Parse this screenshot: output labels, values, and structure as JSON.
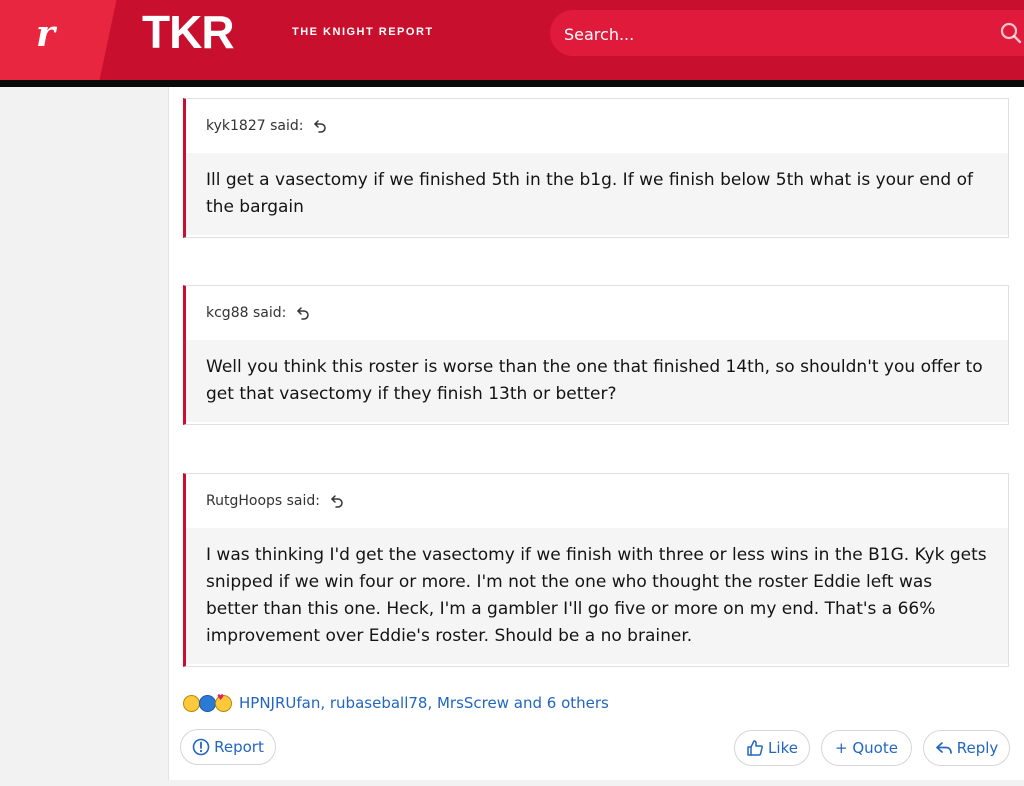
{
  "header": {
    "rivals_logo": "r",
    "brand_logo": "TKR",
    "brand_tagline": "THE KNIGHT REPORT",
    "search": {
      "placeholder": "Search..."
    }
  },
  "quotes": [
    {
      "author_said": "kyk1827 said:",
      "text": "Ill get a vasectomy if we finished 5th in the b1g. If we finish below 5th what is your end of the bargain"
    },
    {
      "author_said": "kcg88 said:",
      "text": "Well you think this roster is worse than the one that finished 14th, so shouldn't you offer to get that vasectomy if they finish 13th or better?"
    },
    {
      "author_said": "RutgHoops said:",
      "text": "I was thinking I'd get the vasectomy if we finish with three or less wins in the B1G. Kyk gets snipped if we win four or more. I'm not the one who thought the roster Eddie left was better than this one. Heck, I'm a gambler I'll go five or more on my end. That's a 66% improvement over Eddie's roster. Should be a no brainer."
    }
  ],
  "reactions": {
    "text": "HPNJRUfan, rubaseball78, MrsScrew and 6 others"
  },
  "actions": {
    "report": "Report",
    "like": "Like",
    "quote": "+ Quote",
    "reply": "Reply"
  },
  "colors": {
    "brand_red": "#c8102e",
    "link_blue": "#2266c2"
  }
}
